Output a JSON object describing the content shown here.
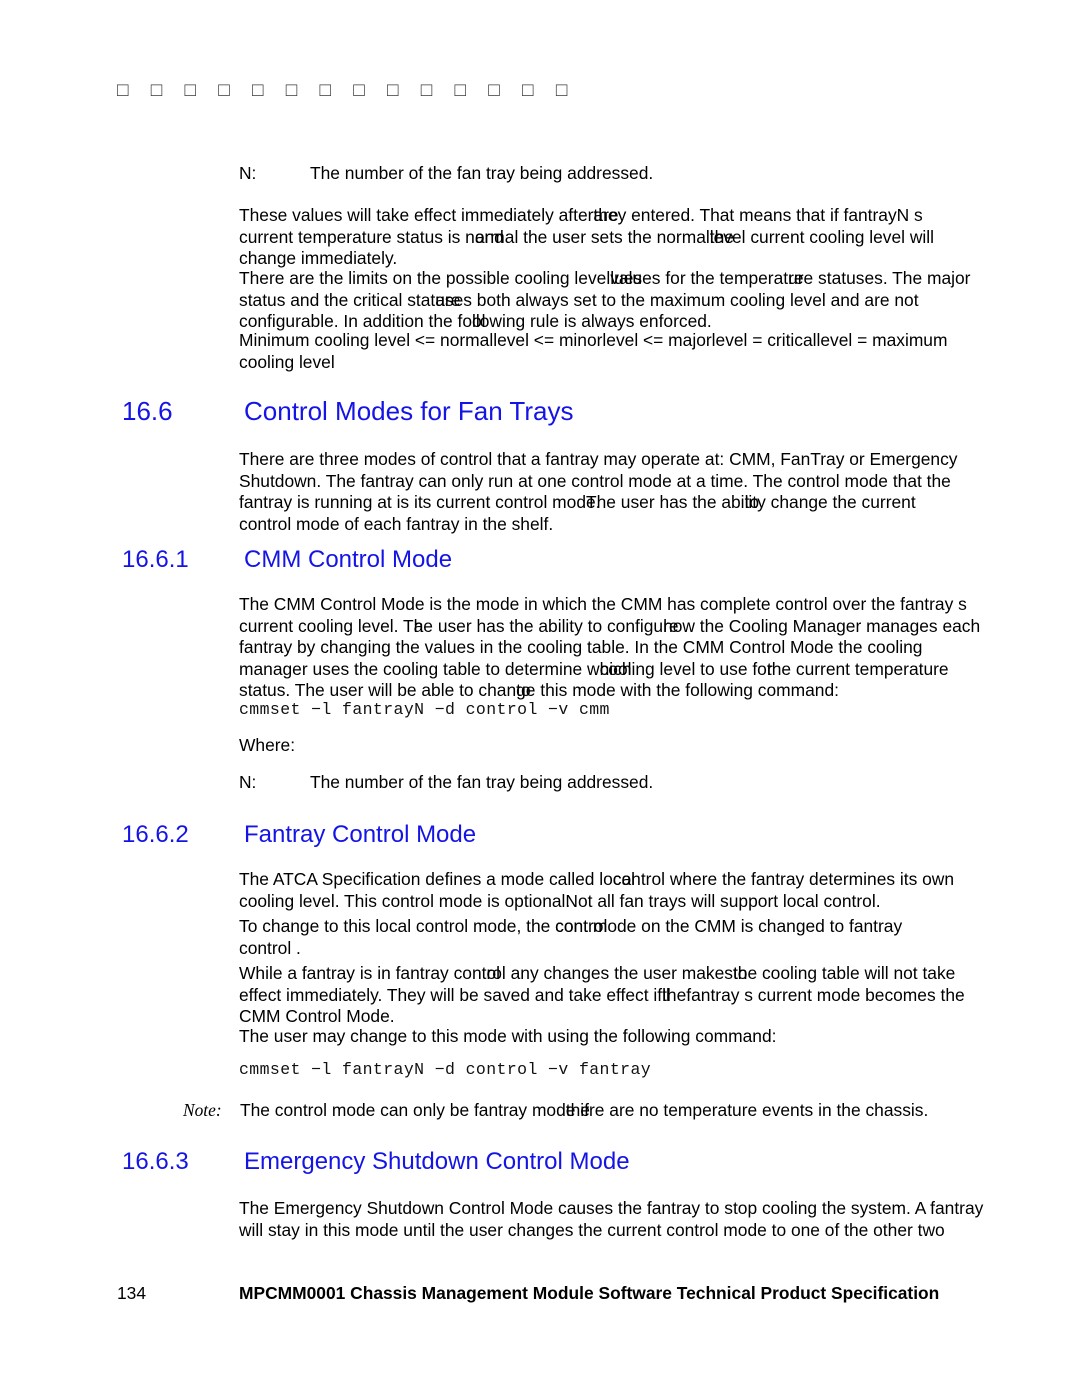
{
  "page": {
    "running_header_glyphs": "□ □ □ □ □ □ □ □ □ □ □ □ □ □",
    "heading_color": "#1414e6",
    "text_color": "#000000",
    "page_number": "134",
    "footer_title": "MPCMM0001 Chassis Management Module Software Technical Product Specification"
  },
  "def1": {
    "term": "N:",
    "definition": "The number of the fan tray being addressed."
  },
  "para1": {
    "seg1": "These values will take effect immediately after",
    "ovl1_a": "they",
    "ovl1_b": "are",
    "seg2": " entered. That means that if fantrayN s",
    "seg3": "current temperature status is n",
    "ovl2_a": "ormal",
    "ovl2_b": "and",
    "seg4": " the user sets the normal",
    "ovl3_a": "level",
    "ovl3_b": "the",
    "seg5": " current cooling level will",
    "seg6": "change immediately."
  },
  "para2": {
    "seg1": "There are the limits on the possible cooling level",
    "ovl1_a": "values",
    "ovl1_b": "lues",
    "seg2": " for the temperat",
    "ovl2_a": "ure",
    "ovl2_b": "re",
    "seg3": " statuses. The major",
    "seg4": "status and the critical stat",
    "ovl3_a": "uses",
    "ovl3_b": "are",
    "seg5": " both always set to the maximum cooling level and are not",
    "seg6": "configurable. In addition the fo",
    "ovl4_a": "llo",
    "ovl4_b": "ol",
    "seg7": "wing rule is always enforced."
  },
  "para3": {
    "line1": "Minimum cooling level <= normallevel <= minorlevel <= majorlevel = criticallevel = maximum",
    "line2": "cooling level"
  },
  "section_166": {
    "number": "16.6",
    "title": "Control Modes for Fan Trays"
  },
  "para4": {
    "seg1": "There are three modes of control that a fantray may operate at: CMM, FanTray or Emergency",
    "seg2": "Shutdown. The fantray can only run at one control mode at a time. The control mode that the",
    "seg3": "fantray is running at is its current control mod",
    "ovl1_a": "e.",
    "ovl1_b": "The",
    "seg4": " user has the abi",
    "ovl2_a": "lity",
    "ovl2_b": "to",
    "seg5": " change the current",
    "seg6": "control mode of each fantray in the shelf."
  },
  "section_1661": {
    "number": "16.6.1",
    "title": "CMM Control Mode"
  },
  "para5": {
    "seg1": "The CMM Control Mode is the mode in which the CMM has complete control over the fantray s",
    "seg2": "current cooling level. T",
    "ovl1_a": "he",
    "ovl1_b": "a",
    "seg3": " user has the ability to configu",
    "ovl2_a": "re",
    "ovl2_b": "how",
    "seg4": " the Cooling Manager manages each",
    "seg5": "fantray by changing the values in the cooling table. In the CMM Control Mode the cooling",
    "seg6": "manager uses the cooling table to determine w",
    "ovl3_a": "hich",
    "ovl3_b": "cool",
    "seg7": "ing level to use fo",
    "ovl4_a": "r",
    "ovl4_b": "the",
    "seg8": " current temperature",
    "seg9": "status. The user will be able to chan",
    "ovl5_a": "ge",
    "ovl5_b": "to",
    "seg10": " this mode with the following command:"
  },
  "cmd1": {
    "text": "cmmset −l fantrayN −d control −v cmm"
  },
  "where1": {
    "label": "Where:"
  },
  "def2": {
    "term": "N:",
    "definition": "The number of the fan tray being addressed."
  },
  "section_1662": {
    "number": "16.6.2",
    "title": "Fantray Control Mode"
  },
  "para6": {
    "seg1": "The ATCA Specification defines a mode called lo",
    "ovl1_a": "cal",
    "ovl1_b": "con",
    "seg2": "trol where the fantray determines its own",
    "seg3": "cooling level. This control mode is optional",
    "ovl2_a": ".",
    "ovl2_b": "N",
    "seg4": "ot all fan trays will support local control."
  },
  "para7": {
    "seg1": "To change to this local control mode, the ",
    "ovl1_a": "control",
    "ovl1_b": "cont",
    "seg2": " mode on the CMM is changed to  fantray",
    "seg3": "control ."
  },
  "para8": {
    "seg1": "While a fantray is in  fantray cont",
    "ovl1_a": "rol",
    "ovl1_b": "ol",
    "seg2": "  any changes the user makes",
    "ovl2_a": " to",
    "ovl2_b": "the",
    "seg3": " cooling table will not take",
    "seg4": "effect immediately. They",
    "ovl3_a": "y",
    "ovl3_b": "",
    "seg5": " will be saved and take effect if",
    "ovl4_a": " the",
    "ovl4_b": "ll",
    "seg6": "fantray s current mode becomes the",
    "seg7": "CMM Control Mode."
  },
  "para9": {
    "line1": "The user may change to this mode with using the following command:"
  },
  "cmd2": {
    "text": "cmmset −l fantrayN −d control −v fantray"
  },
  "note": {
    "label": "Note:",
    "seg1": "The control mode can only be fantray mod",
    "ovl1_a": "e if",
    "ovl1_b": "the",
    "seg2": "re are no temperature events in the chassis."
  },
  "section_1663": {
    "number": "16.6.3",
    "title": "Emergency Shutdown Control Mode"
  },
  "para10": {
    "seg1": "The Emergency Shutdown Control Mode causes the fantray to stop cooling the system. A fantray",
    "seg2": "will stay in this mode until the user changes the current control mode to one of the other two"
  }
}
